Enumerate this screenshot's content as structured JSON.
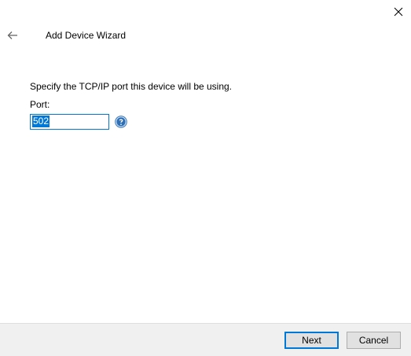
{
  "dialog": {
    "title": "Add Device Wizard",
    "close_icon": "close-icon",
    "back_icon": "back-arrow-icon"
  },
  "form": {
    "instruction": "Specify the TCP/IP port this device will be using.",
    "port_label": "Port:",
    "port_value": "502",
    "help_icon": "help-icon"
  },
  "footer": {
    "next_label": "Next",
    "cancel_label": "Cancel"
  },
  "colors": {
    "accent": "#0078d7",
    "footer_bg": "#f0f0f0",
    "button_bg": "#e1e1e1"
  }
}
